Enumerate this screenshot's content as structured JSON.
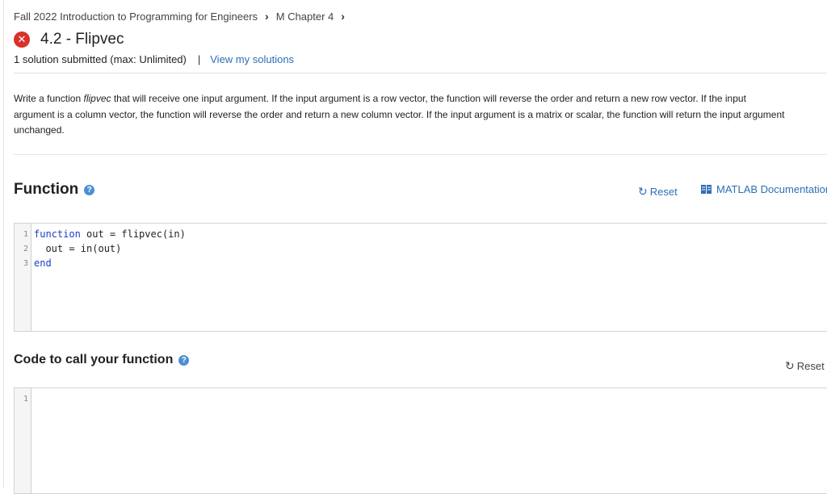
{
  "breadcrumb": {
    "course": "Fall 2022 Introduction to Programming for Engineers",
    "chapter": "M Chapter 4"
  },
  "problem": {
    "title": "4.2 - Flipvec",
    "status_icon": "x-circle-icon",
    "status_color": "#d9312b",
    "submissions": "1 solution submitted (max: Unlimited)",
    "separator": "|",
    "view_solutions": "View my solutions"
  },
  "description": {
    "lead": "Write a function ",
    "fn_name": "flipvec",
    "rest": " that will receive one input argument. If the input argument is a row vector, the function will reverse the order and return a new row vector. If the input argument is a column vector, the function will reverse the order and return a new column vector. If the input argument is a matrix or scalar, the function will return the input argument unchanged."
  },
  "function_section": {
    "title": "Function",
    "help": "?",
    "reset": "Reset",
    "docs": "MATLAB Documentation",
    "lines": [
      {
        "num": "1",
        "kw": "function",
        "text": " out = flipvec(in)"
      },
      {
        "num": "2",
        "kw": "",
        "text": "  out = in(out)"
      },
      {
        "num": "3",
        "kw": "end",
        "text": ""
      }
    ]
  },
  "call_section": {
    "title": "Code to call your function",
    "help": "?",
    "reset": "Reset",
    "lines": [
      {
        "num": "1",
        "text": ""
      }
    ]
  },
  "colors": {
    "link": "#2c6fb5",
    "keyword": "#1a3fc1",
    "help": "#4d8fd0"
  }
}
